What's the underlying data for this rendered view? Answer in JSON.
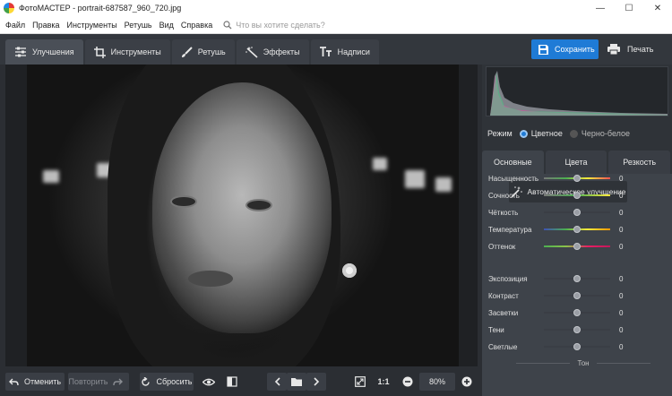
{
  "window": {
    "title": "ФотоМАСТЕР - portrait-687587_960_720.jpg",
    "controls": [
      "—",
      "☐",
      "✕"
    ]
  },
  "menu": {
    "items": [
      "Файл",
      "Правка",
      "Инструменты",
      "Ретушь",
      "Вид",
      "Справка"
    ],
    "search_placeholder": "Что вы хотите сделать?"
  },
  "tabs": [
    {
      "label": "Улучшения",
      "icon": "sliders-icon"
    },
    {
      "label": "Инструменты",
      "icon": "crop-icon"
    },
    {
      "label": "Ретушь",
      "icon": "brush-icon"
    },
    {
      "label": "Эффекты",
      "icon": "magic-wand-icon"
    },
    {
      "label": "Надписи",
      "icon": "text-icon"
    }
  ],
  "actions": {
    "save": "Сохранить",
    "print": "Печать"
  },
  "bottom": {
    "undo": "Отменить",
    "redo": "Повторить",
    "reset": "Сбросить",
    "zoom_ratio": "1:1",
    "zoom": "80%"
  },
  "panel": {
    "mode_label": "Режим",
    "mode_color": "Цветное",
    "mode_bw": "Черно-белое",
    "subtabs": [
      "Основные",
      "Цвета",
      "Резкость"
    ],
    "auto_button": "Автоматическое улучшение",
    "tone_label": "Тон",
    "sliders": [
      {
        "label": "Насыщенность",
        "value": 0,
        "colors": [
          "#777777",
          "#4caf50",
          "#ffeb3b",
          "#ff5252"
        ]
      },
      {
        "label": "Сочность",
        "value": 0,
        "colors": [
          "#777777",
          "#4caf50",
          "#ffeb3b"
        ]
      },
      {
        "label": "Чёткость",
        "value": 0,
        "colors": [
          "#3a3e45",
          "#3a3e45"
        ]
      },
      {
        "label": "Температура",
        "value": 0,
        "colors": [
          "#3f51b5",
          "#4caf50",
          "#ffeb3b",
          "#ff9800"
        ]
      },
      {
        "label": "Оттенок",
        "value": 0,
        "colors": [
          "#4caf50",
          "#8bc34a",
          "#e91e63",
          "#c2185b"
        ]
      },
      {
        "label": "Экспозиция",
        "value": 0,
        "colors": [
          "#3a3e45",
          "#3a3e45"
        ]
      },
      {
        "label": "Контраст",
        "value": 0,
        "colors": [
          "#3a3e45",
          "#3a3e45"
        ]
      },
      {
        "label": "Засветки",
        "value": 0,
        "colors": [
          "#3a3e45",
          "#3a3e45"
        ]
      },
      {
        "label": "Тени",
        "value": 0,
        "colors": [
          "#3a3e45",
          "#3a3e45"
        ]
      },
      {
        "label": "Светлые",
        "value": 0,
        "colors": [
          "#3a3e45",
          "#3a3e45"
        ]
      }
    ]
  },
  "colors": {
    "accent": "#1f7bd6",
    "bg": "#2b2e33",
    "panel": "#3e434a"
  }
}
